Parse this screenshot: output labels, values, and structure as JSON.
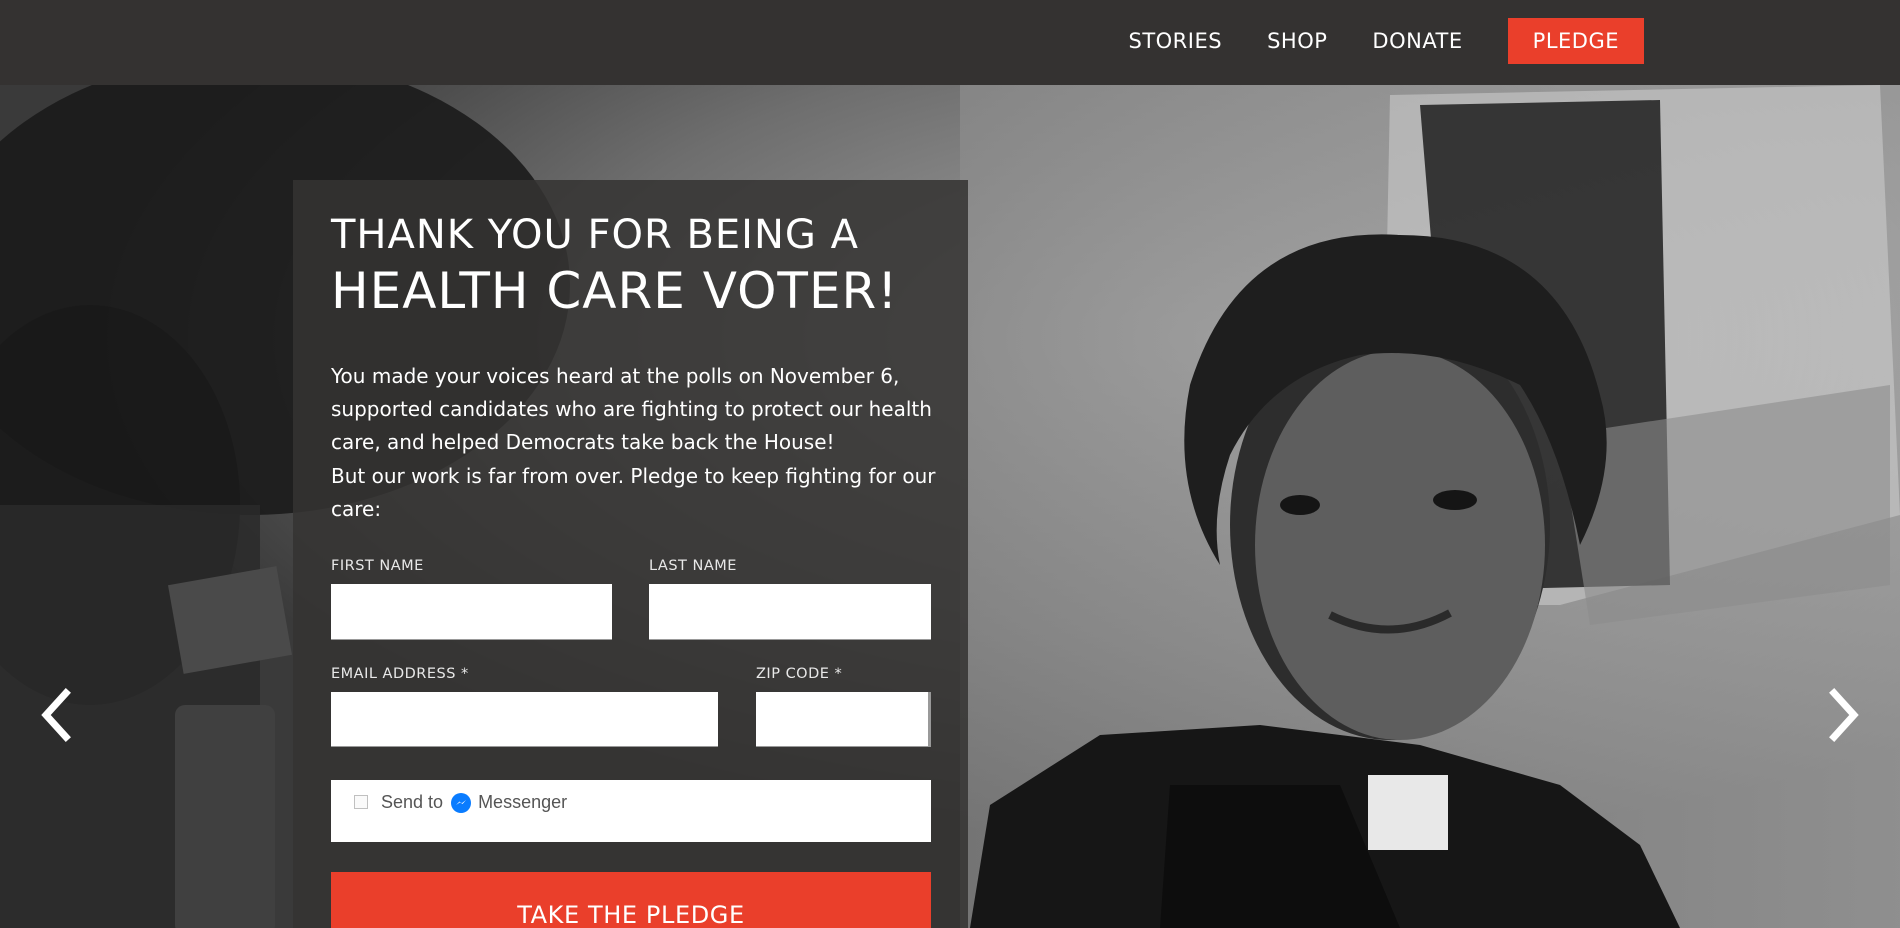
{
  "nav": {
    "stories": "STORIES",
    "shop": "SHOP",
    "donate": "DONATE",
    "pledge": "PLEDGE"
  },
  "card": {
    "heading_line1": "THANK YOU FOR BEING A",
    "heading_line2": "HEALTH CARE VOTER!",
    "paragraph1": "You made your voices heard at the polls on November 6, supported candidates who are fighting to protect our health care, and helped Democrats take back the House!",
    "paragraph2": "But our work is far from over. Pledge to keep fighting for our care:"
  },
  "form": {
    "first_name_label": "FIRST NAME",
    "last_name_label": "LAST NAME",
    "email_label": "EMAIL ADDRESS *",
    "zip_label": "ZIP CODE *",
    "first_name_value": "",
    "last_name_value": "",
    "email_value": "",
    "zip_value": "",
    "messenger_prefix": "Send to",
    "messenger_suffix": "Messenger",
    "messenger_checked": false,
    "submit_label": "TAKE THE PLEDGE"
  },
  "carousel": {
    "prev_icon": "chevron-left-icon",
    "next_icon": "chevron-right-icon"
  },
  "colors": {
    "accent": "#ea3f2b",
    "topbar": "#343231",
    "card_bg": "#343332",
    "messenger_blue": "#0a7cff"
  }
}
